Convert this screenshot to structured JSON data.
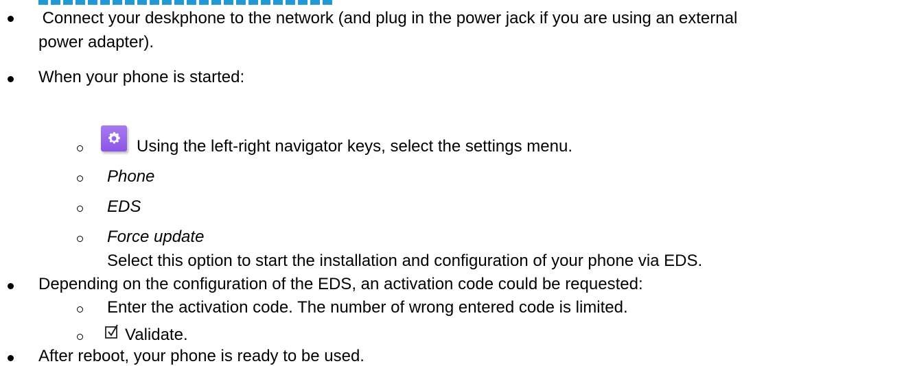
{
  "list": {
    "b1_l1": " Connect your deskphone to the network (and plug in the power jack if you are using an external",
    "b1_l2": "power adapter).",
    "b2": "When your phone is started:",
    "s1": "Using the left-right navigator keys, select the settings menu.",
    "s2": "Phone",
    "s3": "EDS",
    "s4": "Force update",
    "s4_desc": "Select this option to start the installation and configuration of your phone via EDS.",
    "b3": "Depending on the configuration of the EDS, an activation code could be requested:",
    "s5": "Enter the activation code. The number of wrong entered code is limited.",
    "s6": "Validate.",
    "b4": "After reboot, your phone is ready to be used."
  },
  "icons": {
    "settings": "gear-icon",
    "validate": "check-box-icon"
  },
  "colors": {
    "settings_icon_bg": "#9461ea"
  }
}
